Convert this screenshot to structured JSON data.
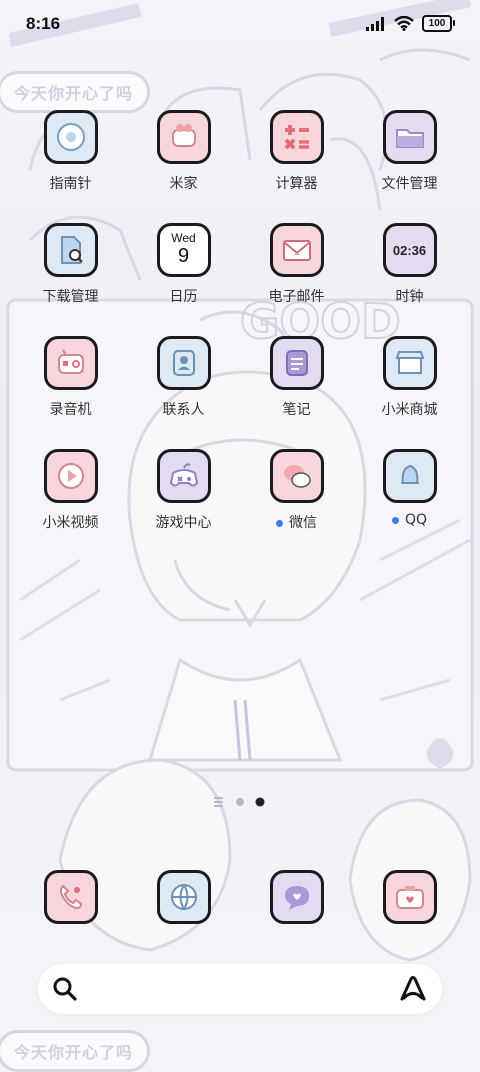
{
  "status": {
    "time": "8:16",
    "battery": "100"
  },
  "wallpaper": {
    "banner_top": "今天你开心了吗",
    "banner_bottom": "今天你开心了吗"
  },
  "apps": [
    {
      "label": "指南针",
      "icon": "compass-icon",
      "bg": "#dfe9f3"
    },
    {
      "label": "米家",
      "icon": "mihome-icon",
      "bg": "#f6d6da"
    },
    {
      "label": "计算器",
      "icon": "calculator-icon",
      "bg": "#f6d6da"
    },
    {
      "label": "文件管理",
      "icon": "folder-icon",
      "bg": "#e3dcf1"
    },
    {
      "label": "下载管理",
      "icon": "download-icon",
      "bg": "#dfe9f3"
    },
    {
      "label": "日历",
      "icon": "calendar-icon",
      "bg": "#ece8f5",
      "weekday": "Wed",
      "day": "9"
    },
    {
      "label": "电子邮件",
      "icon": "mail-icon",
      "bg": "#f6d6da"
    },
    {
      "label": "时钟",
      "icon": "clock-icon",
      "bg": "#e3dcf1",
      "clock_text": "02:36"
    },
    {
      "label": "录音机",
      "icon": "recorder-icon",
      "bg": "#f6d6da"
    },
    {
      "label": "联系人",
      "icon": "contacts-icon",
      "bg": "#dfe9f3"
    },
    {
      "label": "笔记",
      "icon": "notes-icon",
      "bg": "#e3dcf1"
    },
    {
      "label": "小米商城",
      "icon": "store-icon",
      "bg": "#dfe9f3"
    },
    {
      "label": "小米视频",
      "icon": "video-icon",
      "bg": "#f6d6da"
    },
    {
      "label": "游戏中心",
      "icon": "game-icon",
      "bg": "#e3dcf1"
    },
    {
      "label": "微信",
      "icon": "wechat-icon",
      "bg": "#f6d6da",
      "badge": true
    },
    {
      "label": "QQ",
      "icon": "qq-icon",
      "bg": "#dfe9f3",
      "badge": true
    }
  ],
  "dock": [
    {
      "icon": "phone-icon",
      "bg": "#f6d6da"
    },
    {
      "icon": "browser-icon",
      "bg": "#dfe9f3"
    },
    {
      "icon": "messages-icon",
      "bg": "#e3dcf1"
    },
    {
      "icon": "camera-icon",
      "bg": "#f6d6da"
    }
  ],
  "pager": {
    "current_page": 2,
    "total_pages": 2
  }
}
